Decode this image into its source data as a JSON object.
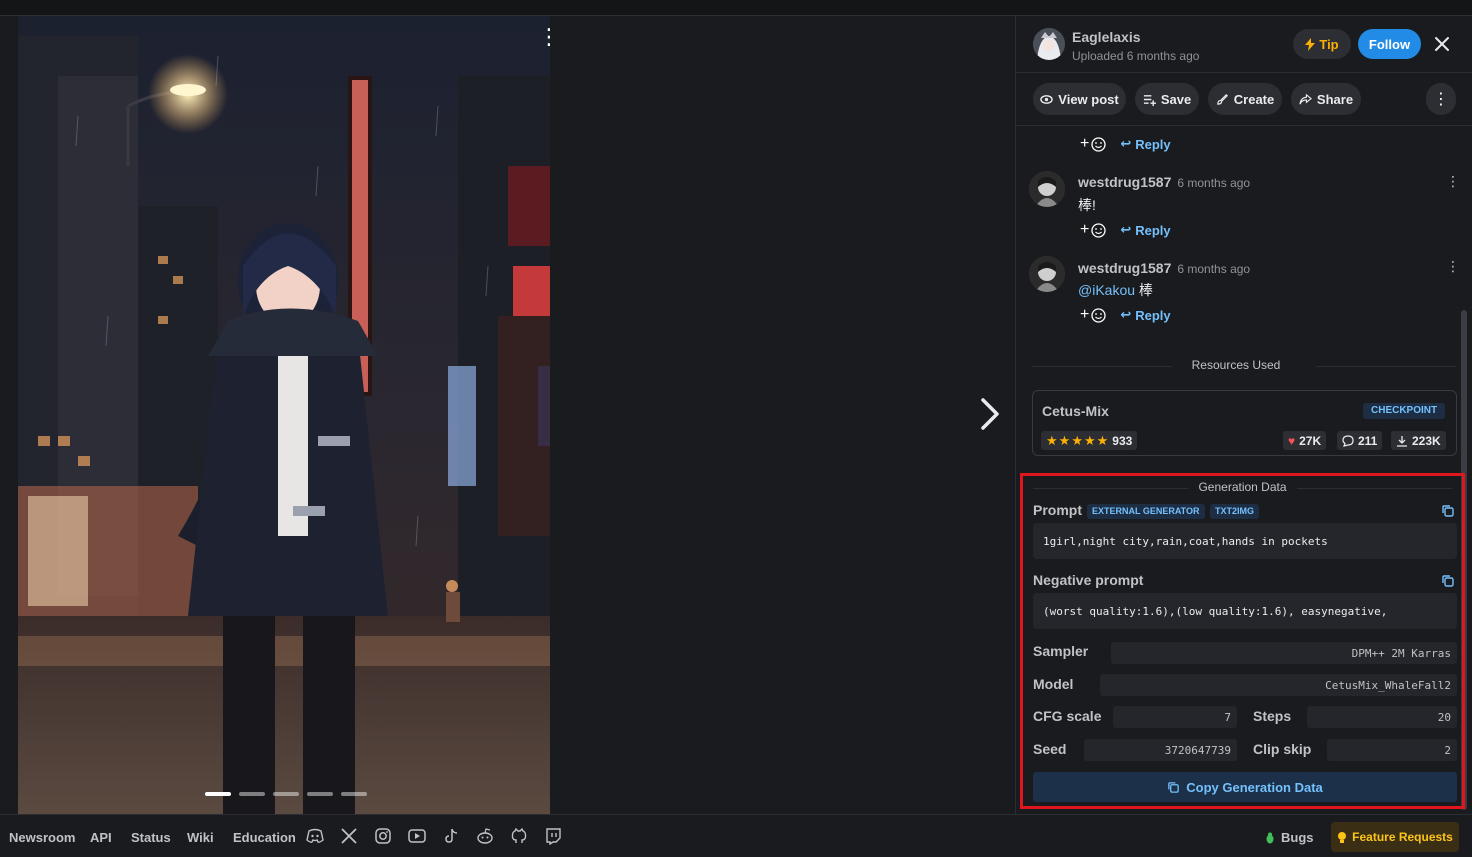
{
  "header": {
    "username": "Eaglelaxis",
    "uploaded": "Uploaded 6 months ago",
    "tip_label": "Tip",
    "follow_label": "Follow"
  },
  "actions": {
    "view_post": "View post",
    "save": "Save",
    "create": "Create",
    "share": "Share"
  },
  "image": {
    "carousel_count": 5,
    "active_index": 0
  },
  "comments": [
    {
      "reply_label": "Reply"
    },
    {
      "author": "westdrug1587",
      "time": "6 months ago",
      "text": "棒!",
      "reply_label": "Reply"
    },
    {
      "author": "westdrug1587",
      "time": "6 months ago",
      "mention": "@iKakou",
      "text": " 棒",
      "reply_label": "Reply"
    }
  ],
  "resources": {
    "title": "Resources Used",
    "items": [
      {
        "name": "Cetus-Mix",
        "type": "CHECKPOINT",
        "rating_count": "933",
        "likes": "27K",
        "comments": "211",
        "downloads": "223K"
      }
    ]
  },
  "generation": {
    "title": "Generation Data",
    "prompt_label": "Prompt",
    "badge_external": "EXTERNAL GENERATOR",
    "badge_txt2img": "TXT2IMG",
    "prompt": "1girl,night city,rain,coat,hands in pockets",
    "negative_label": "Negative prompt",
    "negative_prompt": "(worst quality:1.6),(low quality:1.6), easynegative,",
    "sampler_label": "Sampler",
    "sampler": "DPM++ 2M Karras",
    "model_label": "Model",
    "model": "CetusMix_WhaleFall2",
    "cfg_label": "CFG scale",
    "cfg": "7",
    "steps_label": "Steps",
    "steps": "20",
    "seed_label": "Seed",
    "seed": "3720647739",
    "clip_label": "Clip skip",
    "clip": "2",
    "copy_label": "Copy Generation Data",
    "highlight_color": "#e0161f"
  },
  "footer": {
    "links": [
      "Newsroom",
      "API",
      "Status",
      "Wiki",
      "Education"
    ],
    "socials": [
      "discord-icon",
      "x-icon",
      "instagram-icon",
      "youtube-icon",
      "tiktok-icon",
      "reddit-icon",
      "github-icon",
      "twitch-icon"
    ],
    "bugs": "Bugs",
    "feature_requests": "Feature Requests"
  },
  "colors": {
    "accent": "#228be6",
    "link": "#74c0fc",
    "star": "#fab005"
  }
}
